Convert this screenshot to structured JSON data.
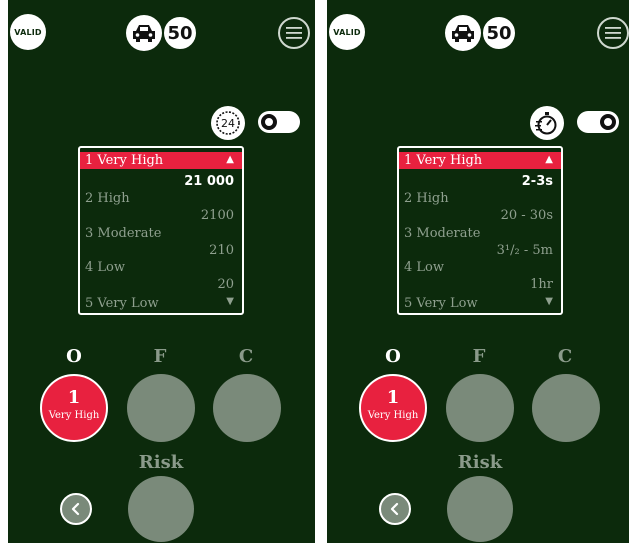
{
  "colors": {
    "background": "#0c2a0c",
    "accent": "#e8213f",
    "muted": "#7a8a7a"
  },
  "screens": [
    {
      "header": {
        "valid_label": "VALID",
        "speed": "50",
        "car_icon": "car-icon",
        "menu_icon": "menu-icon"
      },
      "mode": {
        "icon": "clock-24-icon",
        "icon_text": "24",
        "toggle_state": "off"
      },
      "levels": [
        {
          "label": "1 Very High",
          "value": "21 000",
          "selected": true
        },
        {
          "label": "2 High",
          "value": "2100"
        },
        {
          "label": "3 Moderate",
          "value": "210"
        },
        {
          "label": "4 Low",
          "value": "20"
        },
        {
          "label": "5 Very Low",
          "value": ""
        }
      ],
      "columns": [
        {
          "letter": "O",
          "active": true,
          "num": "1",
          "text": "Very High"
        },
        {
          "letter": "F",
          "active": false
        },
        {
          "letter": "C",
          "active": false
        }
      ],
      "risk_label": "Risk"
    },
    {
      "header": {
        "valid_label": "VALID",
        "speed": "50",
        "car_icon": "car-icon",
        "menu_icon": "menu-icon"
      },
      "mode": {
        "icon": "stopwatch-icon",
        "toggle_state": "on"
      },
      "levels": [
        {
          "label": "1 Very High",
          "value": "2-3s",
          "selected": true
        },
        {
          "label": "2 High",
          "value": "20 - 30s"
        },
        {
          "label": "3 Moderate",
          "value": "3¹/₂ - 5m"
        },
        {
          "label": "4 Low",
          "value": "1hr"
        },
        {
          "label": "5 Very Low",
          "value": ""
        }
      ],
      "columns": [
        {
          "letter": "O",
          "active": true,
          "num": "1",
          "text": "Very High"
        },
        {
          "letter": "F",
          "active": false
        },
        {
          "letter": "C",
          "active": false
        }
      ],
      "risk_label": "Risk"
    }
  ]
}
